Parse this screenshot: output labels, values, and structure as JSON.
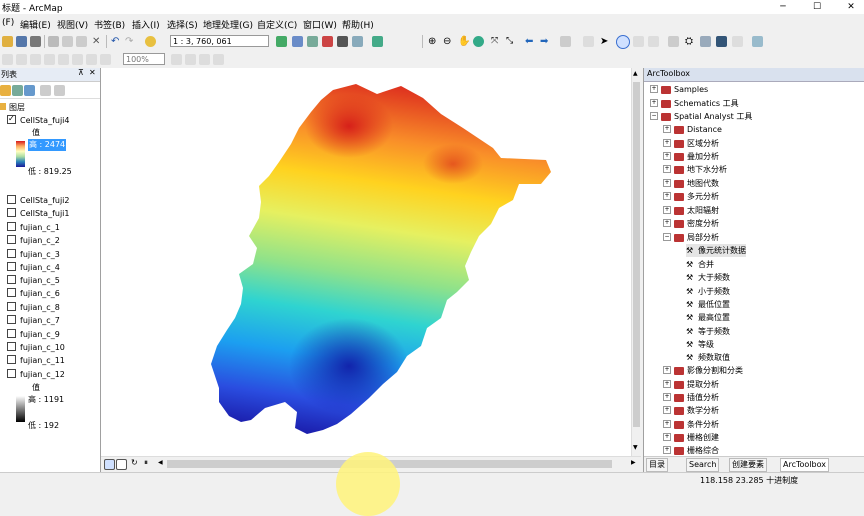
{
  "window": {
    "title": "标题 - ArcMap",
    "minimize": "─",
    "maximize": "☐",
    "close": "✕"
  },
  "menu": [
    "(F)",
    "编辑(E)",
    "视图(V)",
    "书签(B)",
    "插入(I)",
    "选择(S)",
    "地理处理(G)",
    "自定义(C)",
    "窗口(W)",
    "帮助(H)"
  ],
  "toolbar": {
    "scale": "1 : 3, 760, 061",
    "zoom": "100%"
  },
  "toc": {
    "header": "列表",
    "layers_group": "图层",
    "active_layer": {
      "name": "CellSta_fuji4",
      "value_label": "值",
      "high": "高 : 2474",
      "low": "低 : 819.25"
    },
    "layers": [
      "CellSta_fuji2",
      "CellSta_fuji1",
      "fujian_c_1",
      "fujian_c_2",
      "fujian_c_3",
      "fujian_c_4",
      "fujian_c_5",
      "fujian_c_6",
      "fujian_c_8",
      "fujian_c_7",
      "fujian_c_9",
      "fujian_c_10",
      "fujian_c_11",
      "fujian_c_12"
    ],
    "dem_legend": {
      "value_label": "值",
      "high": "高 : 1191",
      "low": "低 : 192"
    }
  },
  "arctoolbox": {
    "title": "ArcToolbox",
    "top_items": [
      "Samples",
      "Schematics 工具",
      "Spatial Analyst 工具"
    ],
    "sa_children": [
      "Distance",
      "区域分析",
      "叠加分析",
      "地下水分析",
      "地图代数",
      "多元分析",
      "太阳辐射",
      "密度分析",
      "局部分析"
    ],
    "local_tools": [
      "像元统计数据",
      "合并",
      "大于频数",
      "小于频数",
      "最低位置",
      "最高位置",
      "等于频数",
      "等级",
      "频数取值"
    ],
    "after_items": [
      "影像分割和分类",
      "提取分析",
      "插值分析",
      "数学分析",
      "条件分析",
      "栅格创建",
      "栅格综合"
    ],
    "tabs": [
      "目录",
      "Search",
      "创建要素",
      "ArcToolbox"
    ]
  },
  "status": {
    "coords": "118.158  23.285 十进制度"
  },
  "colors": {
    "selection": "#3399ff",
    "toolbox_icon": "#b33333"
  }
}
